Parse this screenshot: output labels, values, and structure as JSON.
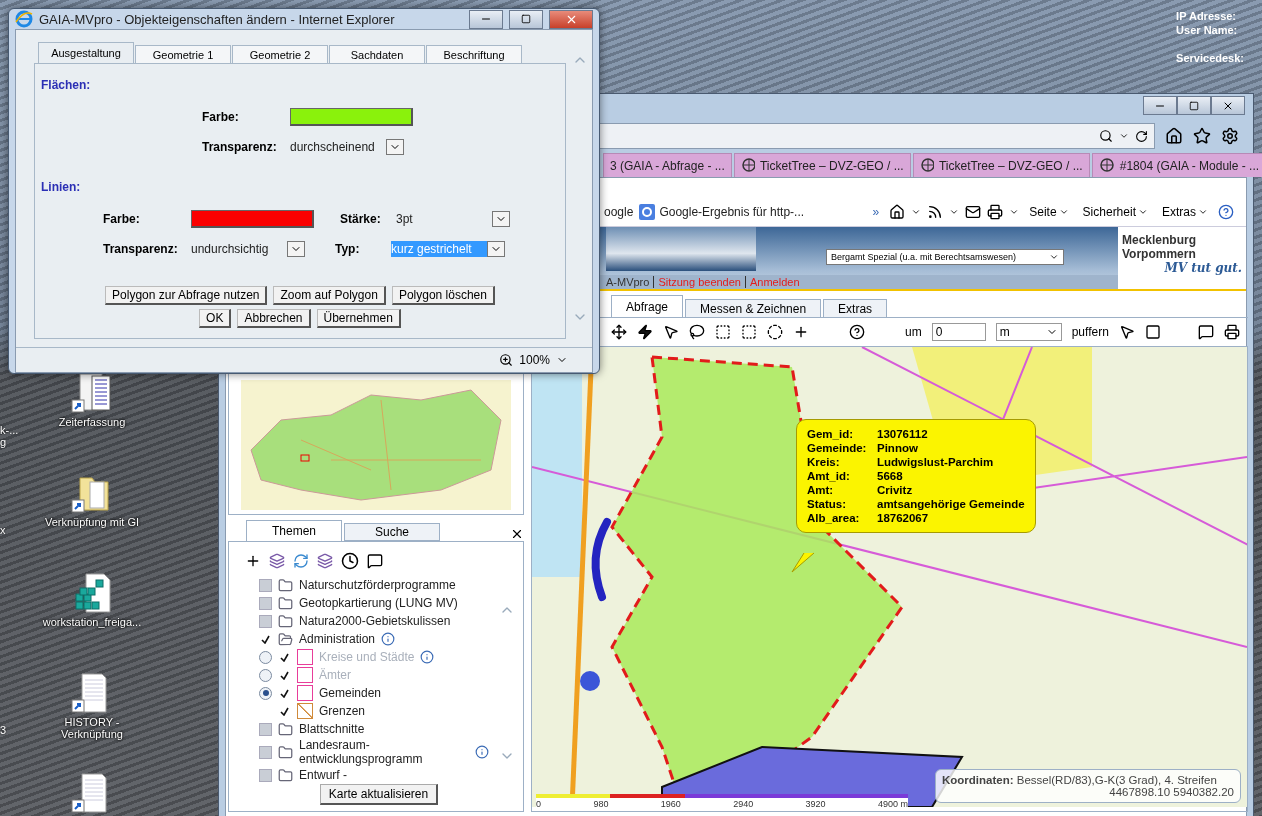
{
  "desktop": {
    "info_labels": [
      "IP Adresse:",
      "User Name:",
      "Servicedesk:"
    ],
    "icons": [
      {
        "label": "Zeiterfassung",
        "kind": "notepad"
      },
      {
        "label": "Verknüpfung mit GI",
        "kind": "folder"
      },
      {
        "label": "workstation_freiga...",
        "kind": "registry"
      },
      {
        "label": "HISTORY - Verknüpfung",
        "kind": "document"
      },
      {
        "kind": "document"
      }
    ],
    "edge_labels": [
      "k-...",
      "g",
      "x",
      "3"
    ]
  },
  "browser": {
    "tabs": [
      {
        "label": "3 (GAIA - Abfrage - ...",
        "kind": "cut"
      },
      {
        "label": "TicketTree – DVZ-GEO / ...",
        "kind": "site"
      },
      {
        "label": "TicketTree – DVZ-GEO / ...",
        "kind": "site"
      },
      {
        "label": "#1804 (GAIA - Module - ...",
        "kind": "site"
      }
    ],
    "favorites": [
      {
        "label": "oogle",
        "kind": "plain"
      },
      {
        "label": "Google-Ergebnis für http-...",
        "kind": "google"
      }
    ],
    "overflow": "»",
    "commands": [
      "Seite",
      "Sicherheit",
      "Extras"
    ]
  },
  "page": {
    "service_select": "Bergamt Spezial (u.a. mit Berechtsamswesen)",
    "links": [
      {
        "label": "A-MVpro",
        "kind": "normal"
      },
      {
        "label": "Sitzung beenden",
        "kind": "action"
      },
      {
        "label": "Anmelden",
        "kind": "action"
      }
    ],
    "logo": {
      "line1": "Mecklenburg",
      "line2": "Vorpommern",
      "slogan": "MV tut gut."
    },
    "tabs": [
      {
        "label": "Abfrage",
        "selected": true
      },
      {
        "label": "Messen & Zeichnen",
        "selected": false
      },
      {
        "label": "Extras",
        "selected": false
      }
    ],
    "buffer": {
      "before": "um",
      "value": "0",
      "unit": "m",
      "after": "puffern"
    },
    "panel_tabs": [
      {
        "label": "Themen",
        "selected": true
      },
      {
        "label": "Suche",
        "selected": false
      }
    ],
    "layers": [
      {
        "label": "Naturschutzförderprogramme",
        "checked": false,
        "expanded": false,
        "info": false
      },
      {
        "label": "Geotopkartierung (LUNG MV)",
        "checked": false,
        "expanded": false,
        "info": false
      },
      {
        "label": "Natura2000-Gebietskulissen",
        "checked": false,
        "expanded": false,
        "info": false
      },
      {
        "label": "Administration",
        "checked": true,
        "expanded": true,
        "info": true,
        "children": [
          {
            "label": "Kreise und Städte",
            "kind": "area",
            "selected": false,
            "checked": true,
            "disabled": true,
            "info": true
          },
          {
            "label": "Ämter",
            "kind": "area",
            "selected": false,
            "checked": true,
            "disabled": true,
            "info": false
          },
          {
            "label": "Gemeinden",
            "kind": "area",
            "selected": true,
            "checked": true,
            "disabled": false,
            "info": false
          },
          {
            "label": "Grenzen",
            "kind": "line",
            "checked": true,
            "disabled": false,
            "info": false
          }
        ]
      },
      {
        "label": "Blattschnitte",
        "checked": false,
        "expanded": false,
        "info": false
      },
      {
        "label": "Landesraum-entwicklungsprogramm",
        "checked": false,
        "expanded": false,
        "info": true
      },
      {
        "label": "Entwurf -",
        "checked": false,
        "expanded": false,
        "info": false
      }
    ],
    "refresh_button": "Karte aktualisieren",
    "tooltip": [
      {
        "key": "Gem_id:",
        "value": "13076112"
      },
      {
        "key": "Gemeinde:",
        "value": "Pinnow"
      },
      {
        "key": "Kreis:",
        "value": "Ludwigslust-Parchim"
      },
      {
        "key": "Amt_id:",
        "value": "5668"
      },
      {
        "key": "Amt:",
        "value": "Crivitz"
      },
      {
        "key": "Status:",
        "value": "amtsangehörige Gemeinde"
      },
      {
        "key": "Alb_area:",
        "value": "18762067"
      }
    ],
    "coordinates": {
      "label": "Koordinaten:",
      "system": "Bessel(RD/83),G-K(3 Grad), 4. Streifen",
      "value": "4467898.10 5940382.20"
    },
    "scale": [
      "0",
      "980",
      "1960",
      "2940",
      "3920",
      "4900 m"
    ]
  },
  "dialog": {
    "title": "GAIA-MVpro - Objekteigenschaften ändern - Internet Explorer",
    "tabs": [
      {
        "label": "Ausgestaltung",
        "selected": true
      },
      {
        "label": "Geometrie 1",
        "selected": false
      },
      {
        "label": "Geometrie 2",
        "selected": false
      },
      {
        "label": "Sachdaten",
        "selected": false
      },
      {
        "label": "Beschriftung",
        "selected": false
      }
    ],
    "sections": [
      {
        "title": "Flächen:",
        "rows": [
          [
            {
              "label": "Farbe:",
              "kind": "color",
              "color": "#8af20c"
            }
          ],
          [
            {
              "label": "Transparenz:",
              "kind": "select",
              "value": "durchscheinend",
              "focused": false
            }
          ]
        ]
      },
      {
        "title": "Linien:",
        "rows": [
          [
            {
              "label": "Farbe:",
              "kind": "color",
              "color": "#fa0000"
            },
            {
              "label": "Stärke:",
              "kind": "select",
              "value": "3pt",
              "focused": false
            }
          ],
          [
            {
              "label": "Transparenz:",
              "kind": "select",
              "value": "undurchsichtig",
              "focused": false
            },
            {
              "label": "Typ:",
              "kind": "select",
              "value": "kurz gestrichelt",
              "focused": true
            }
          ]
        ]
      }
    ],
    "button_rows": [
      [
        "Polygon zur Abfrage nutzen",
        "Zoom auf Polygon",
        "Polygon löschen"
      ],
      [
        "OK",
        "Abbrechen",
        "Übernehmen"
      ]
    ],
    "zoom": "100%"
  }
}
